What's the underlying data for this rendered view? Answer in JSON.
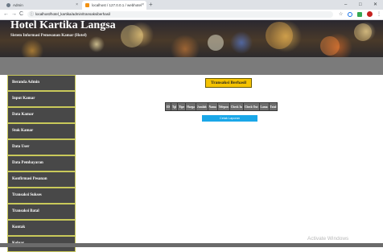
{
  "browser": {
    "tabs": [
      {
        "title": "Admin",
        "close": "×"
      },
      {
        "title": "localhost / 127.0.0.1 / webhotel",
        "close": "×"
      }
    ],
    "new_tab": "+",
    "window_controls": {
      "minimize": "–",
      "maximize": "□",
      "close": "✕"
    },
    "address": {
      "url": "localhost/hotel_kartika/admin/transaksiberhasil",
      "info_icon": "ⓘ",
      "back": "←",
      "forward": "→",
      "reload": "C"
    },
    "extensions": {
      "star": "☆",
      "menu": "⋮"
    }
  },
  "header": {
    "title": "Hotel Kartika Langsa",
    "subtitle": "Sistem Informasi Pemesanan Kamar (Hotel)"
  },
  "sidebar": {
    "items": [
      {
        "label": "Beranda Admin"
      },
      {
        "label": "Input Kamar"
      },
      {
        "label": "Data Kamar"
      },
      {
        "label": "Stok Kamar"
      },
      {
        "label": "Data User"
      },
      {
        "label": "Data Pembayaran"
      },
      {
        "label": "Konfirmasi Pesanan"
      },
      {
        "label": "Transaksi Sukses"
      },
      {
        "label": "Transaksi Batal"
      },
      {
        "label": "Kontak"
      },
      {
        "label": "Keluar"
      }
    ]
  },
  "main": {
    "heading": "Transaksi Berhasil",
    "table_columns": [
      "ID",
      "Tgl",
      "Tipe",
      "Harga",
      "Jumlah",
      "Nama",
      "Telepon",
      "Check In",
      "Check Out",
      "Lama",
      "Total"
    ],
    "print_button": "Cetak Laporan"
  },
  "watermark": "Activate Windows",
  "colors": {
    "sidebar_bg": "#484848",
    "sidebar_border": "#c9c95a",
    "heading_bg": "#f5c300",
    "table_header_bg": "#6d6d6d",
    "print_button_bg": "#1aa7e8"
  }
}
